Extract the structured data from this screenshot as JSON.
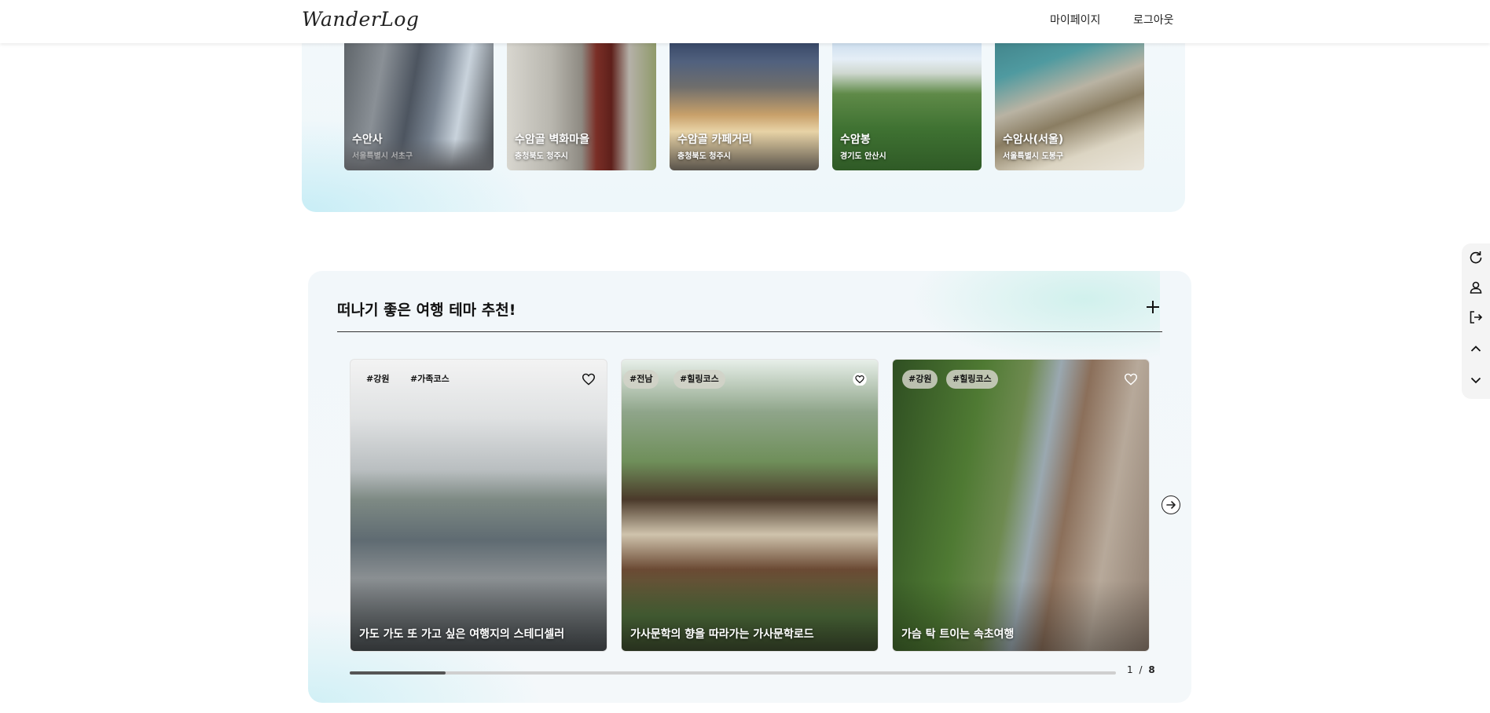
{
  "header": {
    "logo": "WanderLog",
    "nav": {
      "mypage": "마이페이지",
      "logout": "로그아웃"
    }
  },
  "places": [
    {
      "name": "수안사",
      "region": "서울특별시 서초구"
    },
    {
      "name": "수암골 벽화마을",
      "region": "충청북도 청주시"
    },
    {
      "name": "수암골 카페거리",
      "region": "충청북도 청주시"
    },
    {
      "name": "수암봉",
      "region": "경기도 안산시"
    },
    {
      "name": "수암사(서울)",
      "region": "서울특별시 도봉구"
    }
  ],
  "themes": {
    "title": "떠나기 좋은 여행 테마 추천!",
    "cards": [
      {
        "tags": [
          "#강원",
          "#가족코스"
        ],
        "title": "가도 가도 또 가고 싶은 여행지의 스테디셀러"
      },
      {
        "tags": [
          "#전남",
          "#힐링코스"
        ],
        "title": "가사문학의 향을 따라가는 가사문학로드"
      },
      {
        "tags": [
          "#강원",
          "#힐링코스"
        ],
        "title": "가슴 탁 트이는 속초여행"
      }
    ],
    "pagination": {
      "current": "1",
      "separator": "/",
      "total": "8"
    },
    "progress_fraction": 0.125
  },
  "side_menu": [
    "refresh-icon",
    "user-icon",
    "logout-icon",
    "chevron-up-icon",
    "chevron-down-icon"
  ]
}
